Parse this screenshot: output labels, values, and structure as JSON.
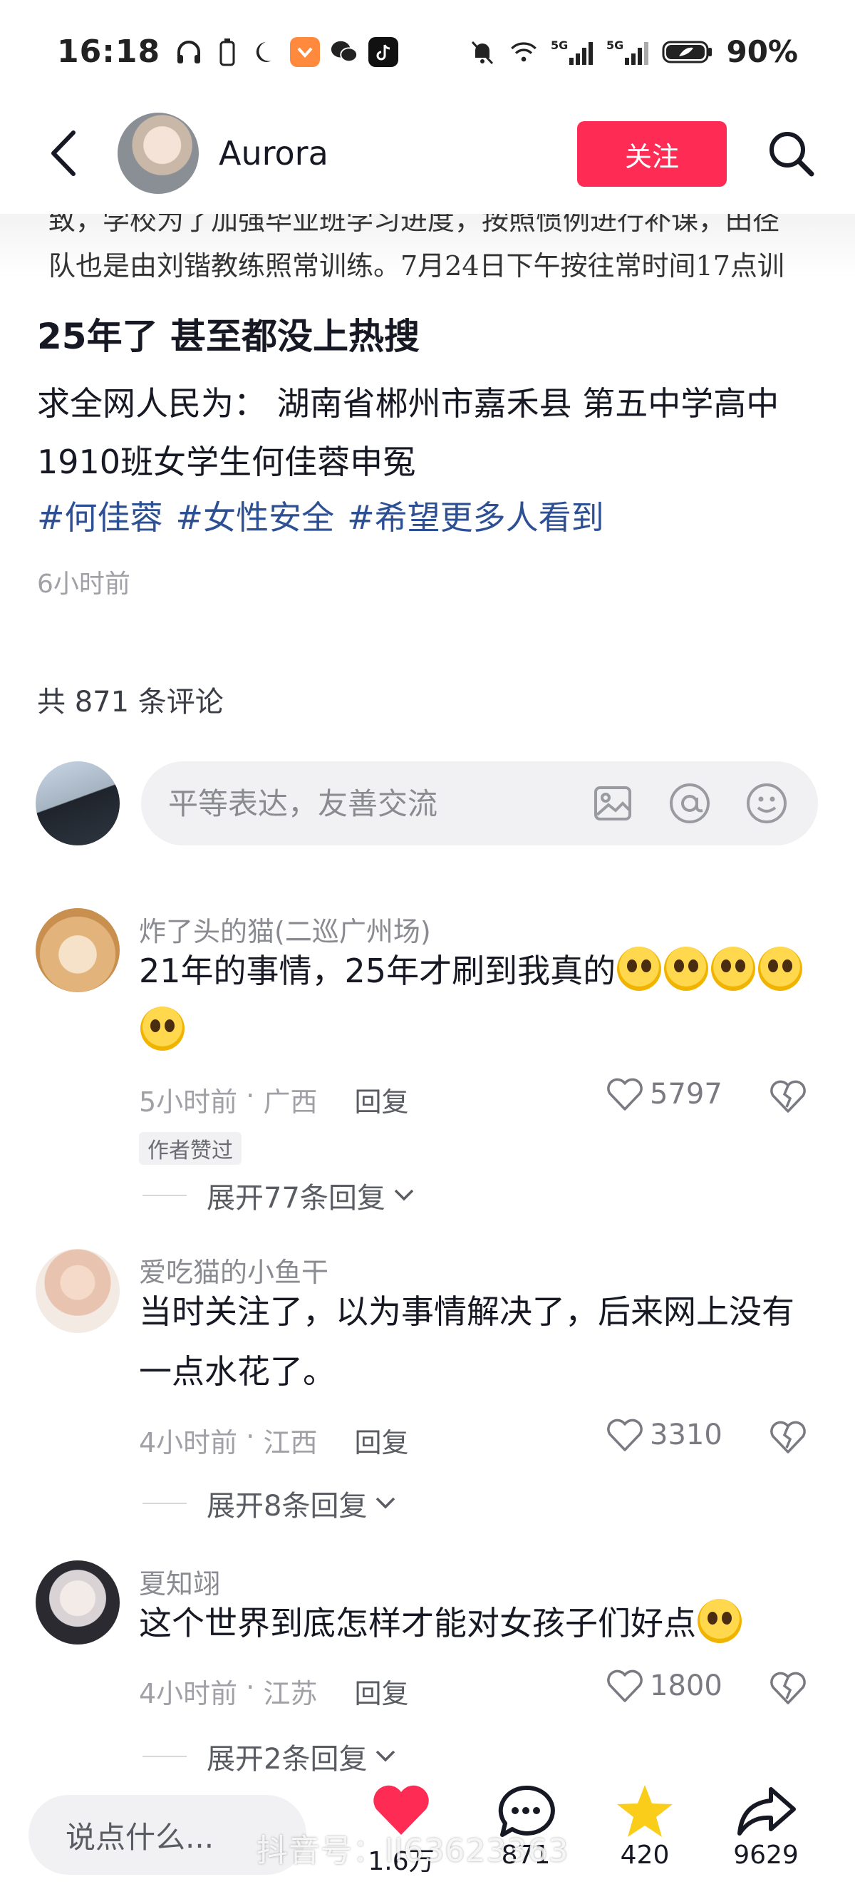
{
  "status_bar": {
    "time": "16:18",
    "battery": "90%",
    "signal_1": "5G",
    "signal_2": "5G"
  },
  "header": {
    "author_name": "Aurora",
    "follow_label": "关注"
  },
  "image_strip": {
    "line1": "致，学校为了加强毕业班学习进度，按照惯例进行补课，田径",
    "line2": "队也是由刘锴教练照常训练。7月24日下午按往常时间17点训"
  },
  "post": {
    "title": "25年了 甚至都没上热搜",
    "body": "求全网人民为： 湖南省郴州市嘉禾县 第五中学高中1910班女学生何佳蓉申冤",
    "hashtags": [
      "#何佳蓉",
      "#女性安全",
      "#希望更多人看到"
    ],
    "time": "6小时前"
  },
  "comments_header": {
    "count_text": "共 871 条评论"
  },
  "comment_input": {
    "placeholder": "平等表达，友善交流",
    "icons": [
      "image-icon",
      "at-icon",
      "emoji-icon"
    ]
  },
  "comments": [
    {
      "user": "炸了头的猫(二巡广州场)",
      "text": "21年的事情，25年才刷到我真的",
      "emoji": "pleading-face",
      "time": "5小时前",
      "location": "广西",
      "reply_label": "回复",
      "likes": "5797",
      "author_liked": "作者赞过",
      "expand": "展开77条回复"
    },
    {
      "user": "爱吃猫的小鱼干",
      "text": "当时关注了，以为事情解决了，后来网上没有一点水花了。",
      "time": "4小时前",
      "location": "江西",
      "reply_label": "回复",
      "likes": "3310",
      "expand": "展开8条回复"
    },
    {
      "user": "夏知翊",
      "text": "这个世界到底怎样才能对女孩子们好点",
      "emoji": "crying-face",
      "time": "4小时前",
      "location": "江苏",
      "reply_label": "回复",
      "likes": "1800",
      "expand": "展开2条回复"
    }
  ],
  "bottom_bar": {
    "input_placeholder": "说点什么...",
    "likes": "1.6万",
    "comments": "871",
    "favorites": "420",
    "shares": "9629",
    "watermark": "抖音号：ll63623363"
  },
  "colors": {
    "accent_red": "#fe2c55",
    "hashtag_blue": "#2d4f93",
    "star_yellow": "#facd1a"
  }
}
